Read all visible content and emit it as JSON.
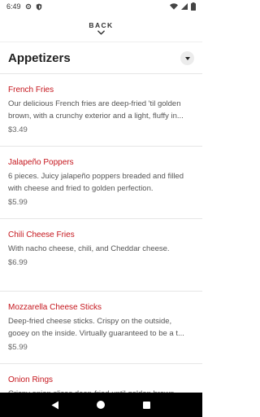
{
  "status_bar": {
    "time": "6:49",
    "icons": [
      "settings-icon",
      "shield-icon",
      "wifi-icon",
      "signal-icon",
      "battery-icon"
    ]
  },
  "nav": {
    "back_label": "BACK",
    "back_icon": "chevron-down-icon"
  },
  "section": {
    "title": "Appetizers",
    "toggle_icon": "caret-down-icon"
  },
  "items": [
    {
      "name": "French Fries",
      "description": "Our delicious French fries are deep-fried 'til golden brown, with a crunchy exterior and a light, fluffy in...",
      "price": "$3.49"
    },
    {
      "name": "Jalapeño Poppers",
      "description": "6 pieces. Juicy jalapeño poppers breaded and filled with cheese and fried to golden perfection.",
      "price": "$5.99"
    },
    {
      "name": "Chili Cheese Fries",
      "description": "With nacho cheese, chili, and Cheddar cheese.",
      "price": "$6.99"
    },
    {
      "name": "Mozzarella Cheese Sticks",
      "description": "Deep-fried cheese sticks. Crispy on the outside, gooey on the inside. Virtually guaranteed to be a t...",
      "price": "$5.99"
    },
    {
      "name": "Onion Rings",
      "description": "Crispy onion slices deep-fried until golden brown.",
      "price": ""
    }
  ],
  "system_nav": {
    "icons": [
      "back-triangle-icon",
      "home-circle-icon",
      "recents-square-icon"
    ]
  },
  "colors": {
    "item_name": "#c5161d",
    "text": "#222222",
    "muted": "#555555",
    "divider": "#e6e6e6",
    "nav_bar": "#000000"
  }
}
